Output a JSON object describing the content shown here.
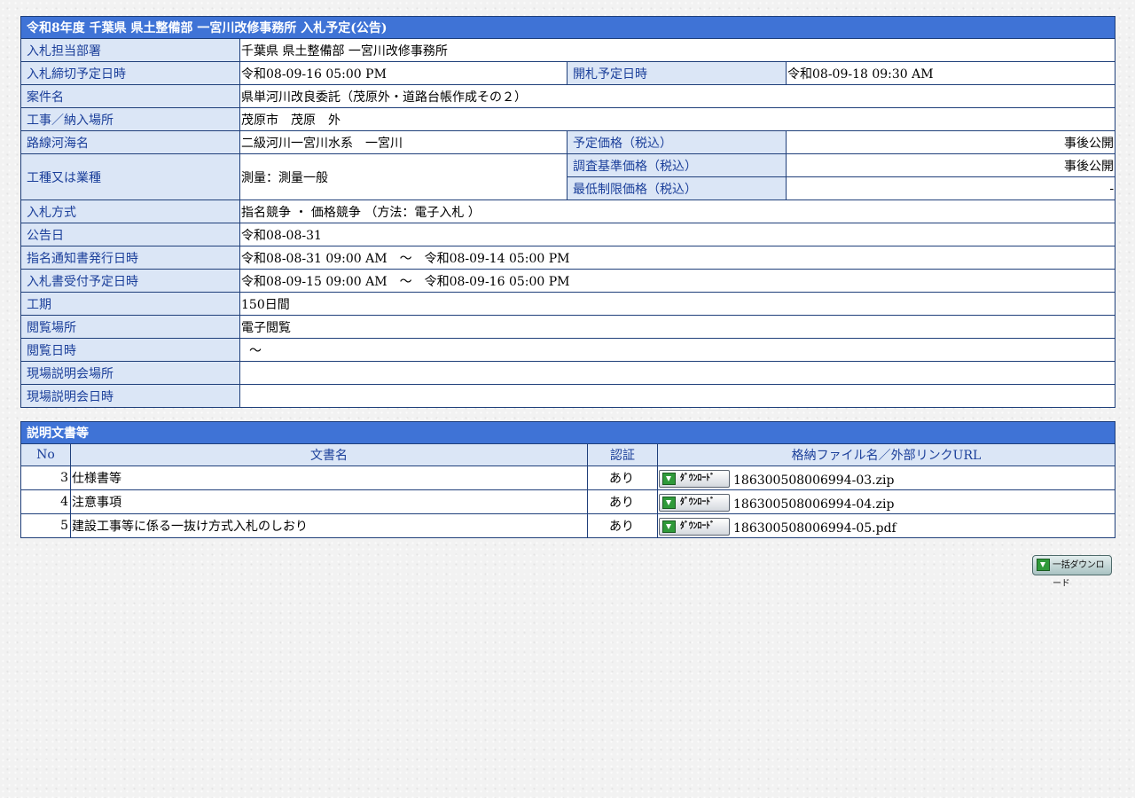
{
  "announcement": {
    "title": "令和8年度 千葉県 県土整備部 一宮川改修事務所 入札予定(公告)",
    "rows": {
      "dept": {
        "label": "入札担当部署",
        "value": "千葉県 県土整備部 一宮川改修事務所"
      },
      "deadline": {
        "label": "入札締切予定日時",
        "value": "令和08-09-16 05:00 PM"
      },
      "opening": {
        "label": "開札予定日時",
        "value": "令和08-09-18 09:30 AM"
      },
      "case_name": {
        "label": "案件名",
        "value": "県単河川改良委託（茂原外・道路台帳作成その２）"
      },
      "location": {
        "label": "工事／納入場所",
        "value": "茂原市　茂原　外"
      },
      "route": {
        "label": "路線河海名",
        "value": "二級河川一宮川水系　一宮川"
      },
      "planned_price": {
        "label": "予定価格（税込）",
        "value": "事後公開"
      },
      "survey_price": {
        "label": "調査基準価格（税込）",
        "value": "事後公開"
      },
      "min_price": {
        "label": "最低制限価格（税込）",
        "value": "-"
      },
      "work_type": {
        "label": "工種又は業種",
        "value": "測量：測量一般"
      },
      "method": {
        "label": "入札方式",
        "value": "指名競争 ・ 価格競争 （方法：電子入札 ）"
      },
      "announce_date": {
        "label": "公告日",
        "value": "令和08-08-31"
      },
      "notice_period": {
        "label": "指名通知書発行日時",
        "value": "令和08-08-31 09:00 AM　～　令和08-09-14 05:00 PM"
      },
      "bid_accept": {
        "label": "入札書受付予定日時",
        "value": "令和08-09-15 09:00 AM　～　令和08-09-16 05:00 PM"
      },
      "term": {
        "label": "工期",
        "value": "150日間"
      },
      "view_place": {
        "label": "閲覧場所",
        "value": "電子閲覧"
      },
      "view_date": {
        "label": "閲覧日時",
        "value": "～"
      },
      "site_place": {
        "label": "現場説明会場所",
        "value": ""
      },
      "site_date": {
        "label": "現場説明会日時",
        "value": ""
      }
    }
  },
  "documents": {
    "title": "説明文書等",
    "headers": {
      "no": "No",
      "name": "文書名",
      "auth": "認証",
      "file": "格納ファイル名／外部リンクURL"
    },
    "download_label": "ﾀﾞｳﾝﾛｰﾄﾞ",
    "items": [
      {
        "no": "3",
        "name": "仕様書等",
        "auth": "あり",
        "file": "186300508006994-03.zip"
      },
      {
        "no": "4",
        "name": "注意事項",
        "auth": "あり",
        "file": "186300508006994-04.zip"
      },
      {
        "no": "5",
        "name": "建設工事等に係る一抜け方式入札のしおり",
        "auth": "あり",
        "file": "186300508006994-05.pdf"
      }
    ]
  },
  "bulk_download_label": "一括ダウンロード"
}
